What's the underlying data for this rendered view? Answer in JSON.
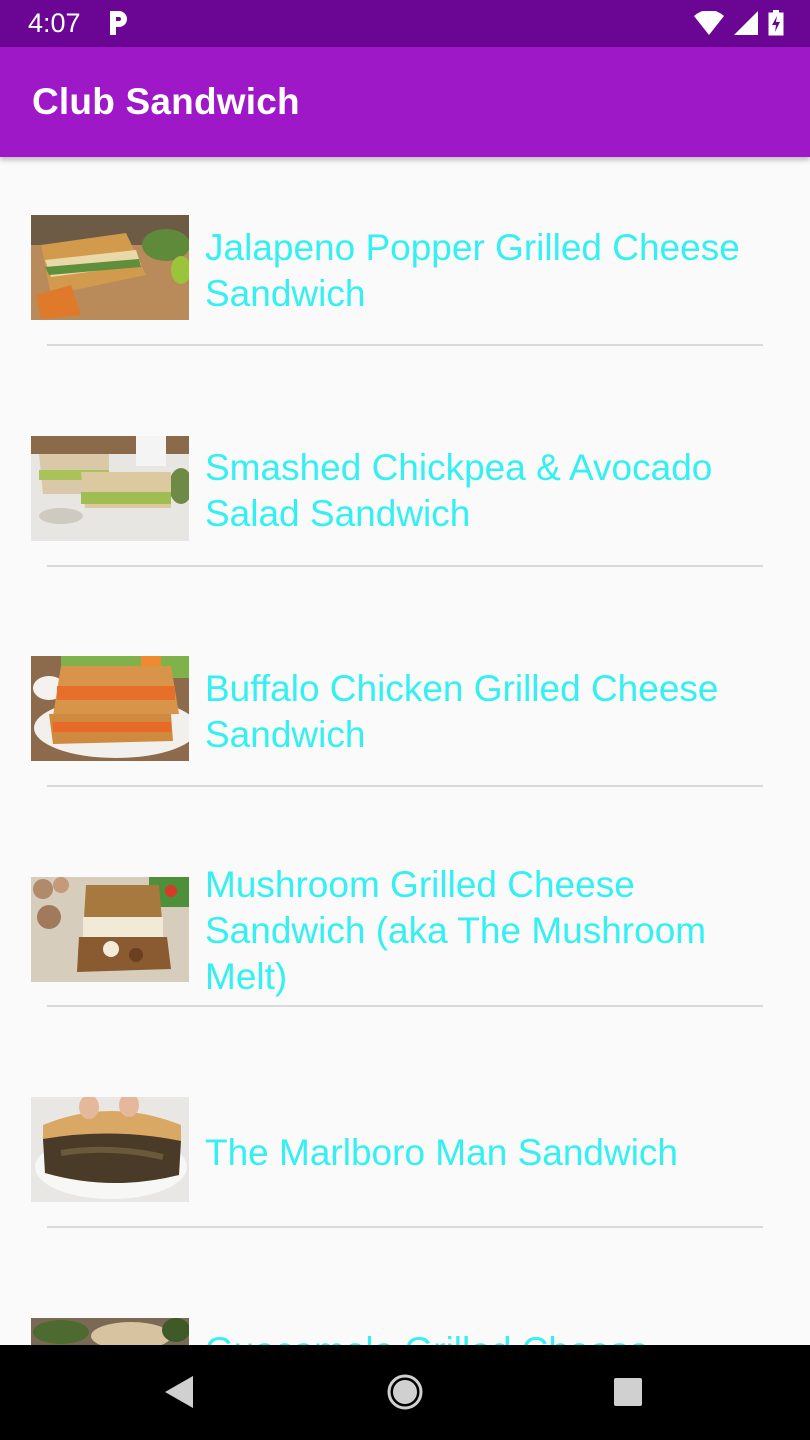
{
  "status_bar": {
    "time": "4:07",
    "icons": [
      "parking-icon",
      "wifi-icon",
      "signal-icon",
      "battery-charging-icon"
    ]
  },
  "app_bar": {
    "title": "Club Sandwich",
    "color": "#9f18c8"
  },
  "recipes": [
    {
      "title": "Jalapeno Popper Grilled Cheese Sandwich"
    },
    {
      "title": "Smashed Chickpea & Avocado Salad Sandwich"
    },
    {
      "title": "Buffalo Chicken Grilled Cheese Sandwich"
    },
    {
      "title": "Mushroom Grilled Cheese Sandwich (aka The Mushroom Melt)"
    },
    {
      "title": "The Marlboro Man Sandwich"
    },
    {
      "title": "Guacamole Grilled Cheese"
    }
  ],
  "colors": {
    "title_text": "#35f0f2",
    "status_bar": "#6a0594",
    "background": "#fafafa"
  },
  "nav_bar": {
    "icons": [
      "back-icon",
      "home-icon",
      "recents-icon"
    ]
  }
}
